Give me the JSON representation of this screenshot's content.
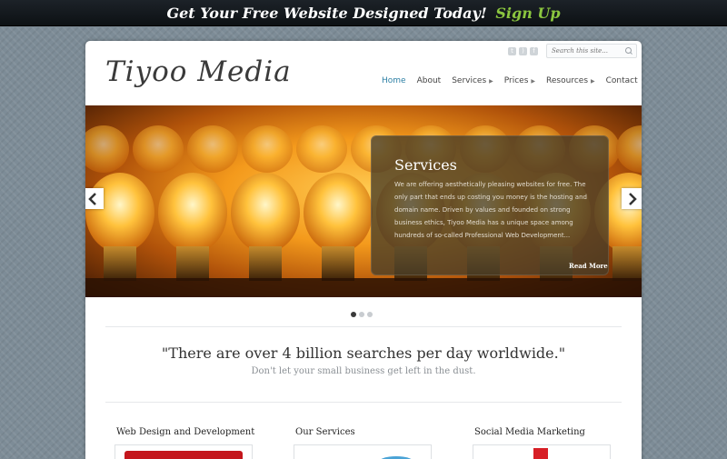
{
  "banner": {
    "text": "Get Your Free Website Designed Today!",
    "cta": "Sign Up"
  },
  "header": {
    "logo": "Tiyoo Media",
    "search_placeholder": "Search this site...",
    "social_icons": [
      "twitter-icon",
      "rss-icon",
      "facebook-icon"
    ]
  },
  "nav": {
    "items": [
      {
        "label": "Home",
        "active": true,
        "dropdown": false
      },
      {
        "label": "About",
        "active": false,
        "dropdown": false
      },
      {
        "label": "Services",
        "active": false,
        "dropdown": true
      },
      {
        "label": "Prices",
        "active": false,
        "dropdown": true
      },
      {
        "label": "Resources",
        "active": false,
        "dropdown": true
      },
      {
        "label": "Contact",
        "active": false,
        "dropdown": false
      }
    ]
  },
  "slider": {
    "title": "Services",
    "text": "We are offering aesthetically pleasing websites for free. The only part that ends up costing you money is the hosting and domain name. Driven by values and founded on strong business ethics, Tiyoo Media has a unique space among hundreds of so-called Professional Web Development...",
    "read_more": "Read More",
    "slide_count": 3,
    "active_slide": 1
  },
  "tagline": {
    "quote": "\"There are over 4 billion searches per day worldwide.\"",
    "sub": "Don't let your small business get left in the dust."
  },
  "columns": [
    {
      "title": "Web Design and Development"
    },
    {
      "title": "Our Services"
    },
    {
      "title": "Social Media Marketing"
    }
  ],
  "colors": {
    "accent_green": "#8bc63f",
    "nav_active": "#2c7fa4",
    "background": "#7d8c97"
  }
}
